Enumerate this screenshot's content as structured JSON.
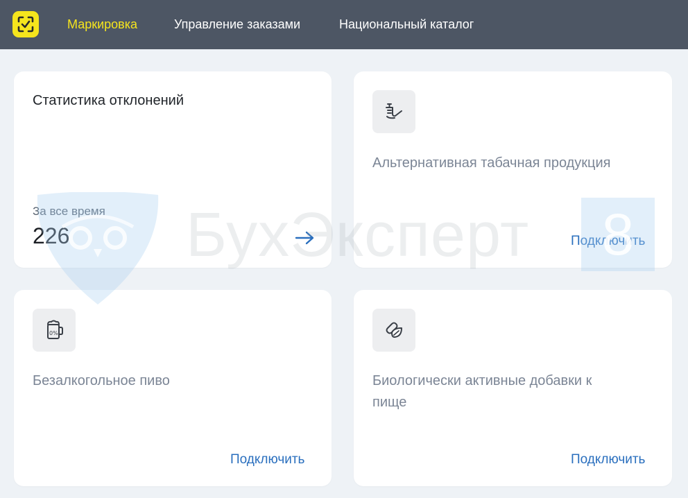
{
  "header": {
    "logo_icon": "checkmark-scan-icon",
    "nav": [
      {
        "label": "Маркировка",
        "active": true
      },
      {
        "label": "Управление заказами",
        "active": false
      },
      {
        "label": "Национальный каталог",
        "active": false
      }
    ],
    "colors": {
      "bar": "#4d5664",
      "accent": "#f6e51d"
    }
  },
  "cards": {
    "stats": {
      "title": "Статистика отклонений",
      "caption": "За все время",
      "value": "226",
      "arrow_icon": "arrow-right-icon"
    },
    "tobacco": {
      "icon": "pipe-icon",
      "label": "Альтернативная табачная продукция",
      "action": "Подключить"
    },
    "beer": {
      "icon": "beer-mug-icon",
      "label": "Безалкогольное пиво",
      "action": "Подключить"
    },
    "supplements": {
      "icon": "leaf-capsule-icon",
      "label_line1": "Биологически активные добавки к",
      "label_line2": "пище",
      "action": "Подключить"
    }
  },
  "watermark": {
    "text": "БухЭксперт",
    "badge": "8"
  }
}
